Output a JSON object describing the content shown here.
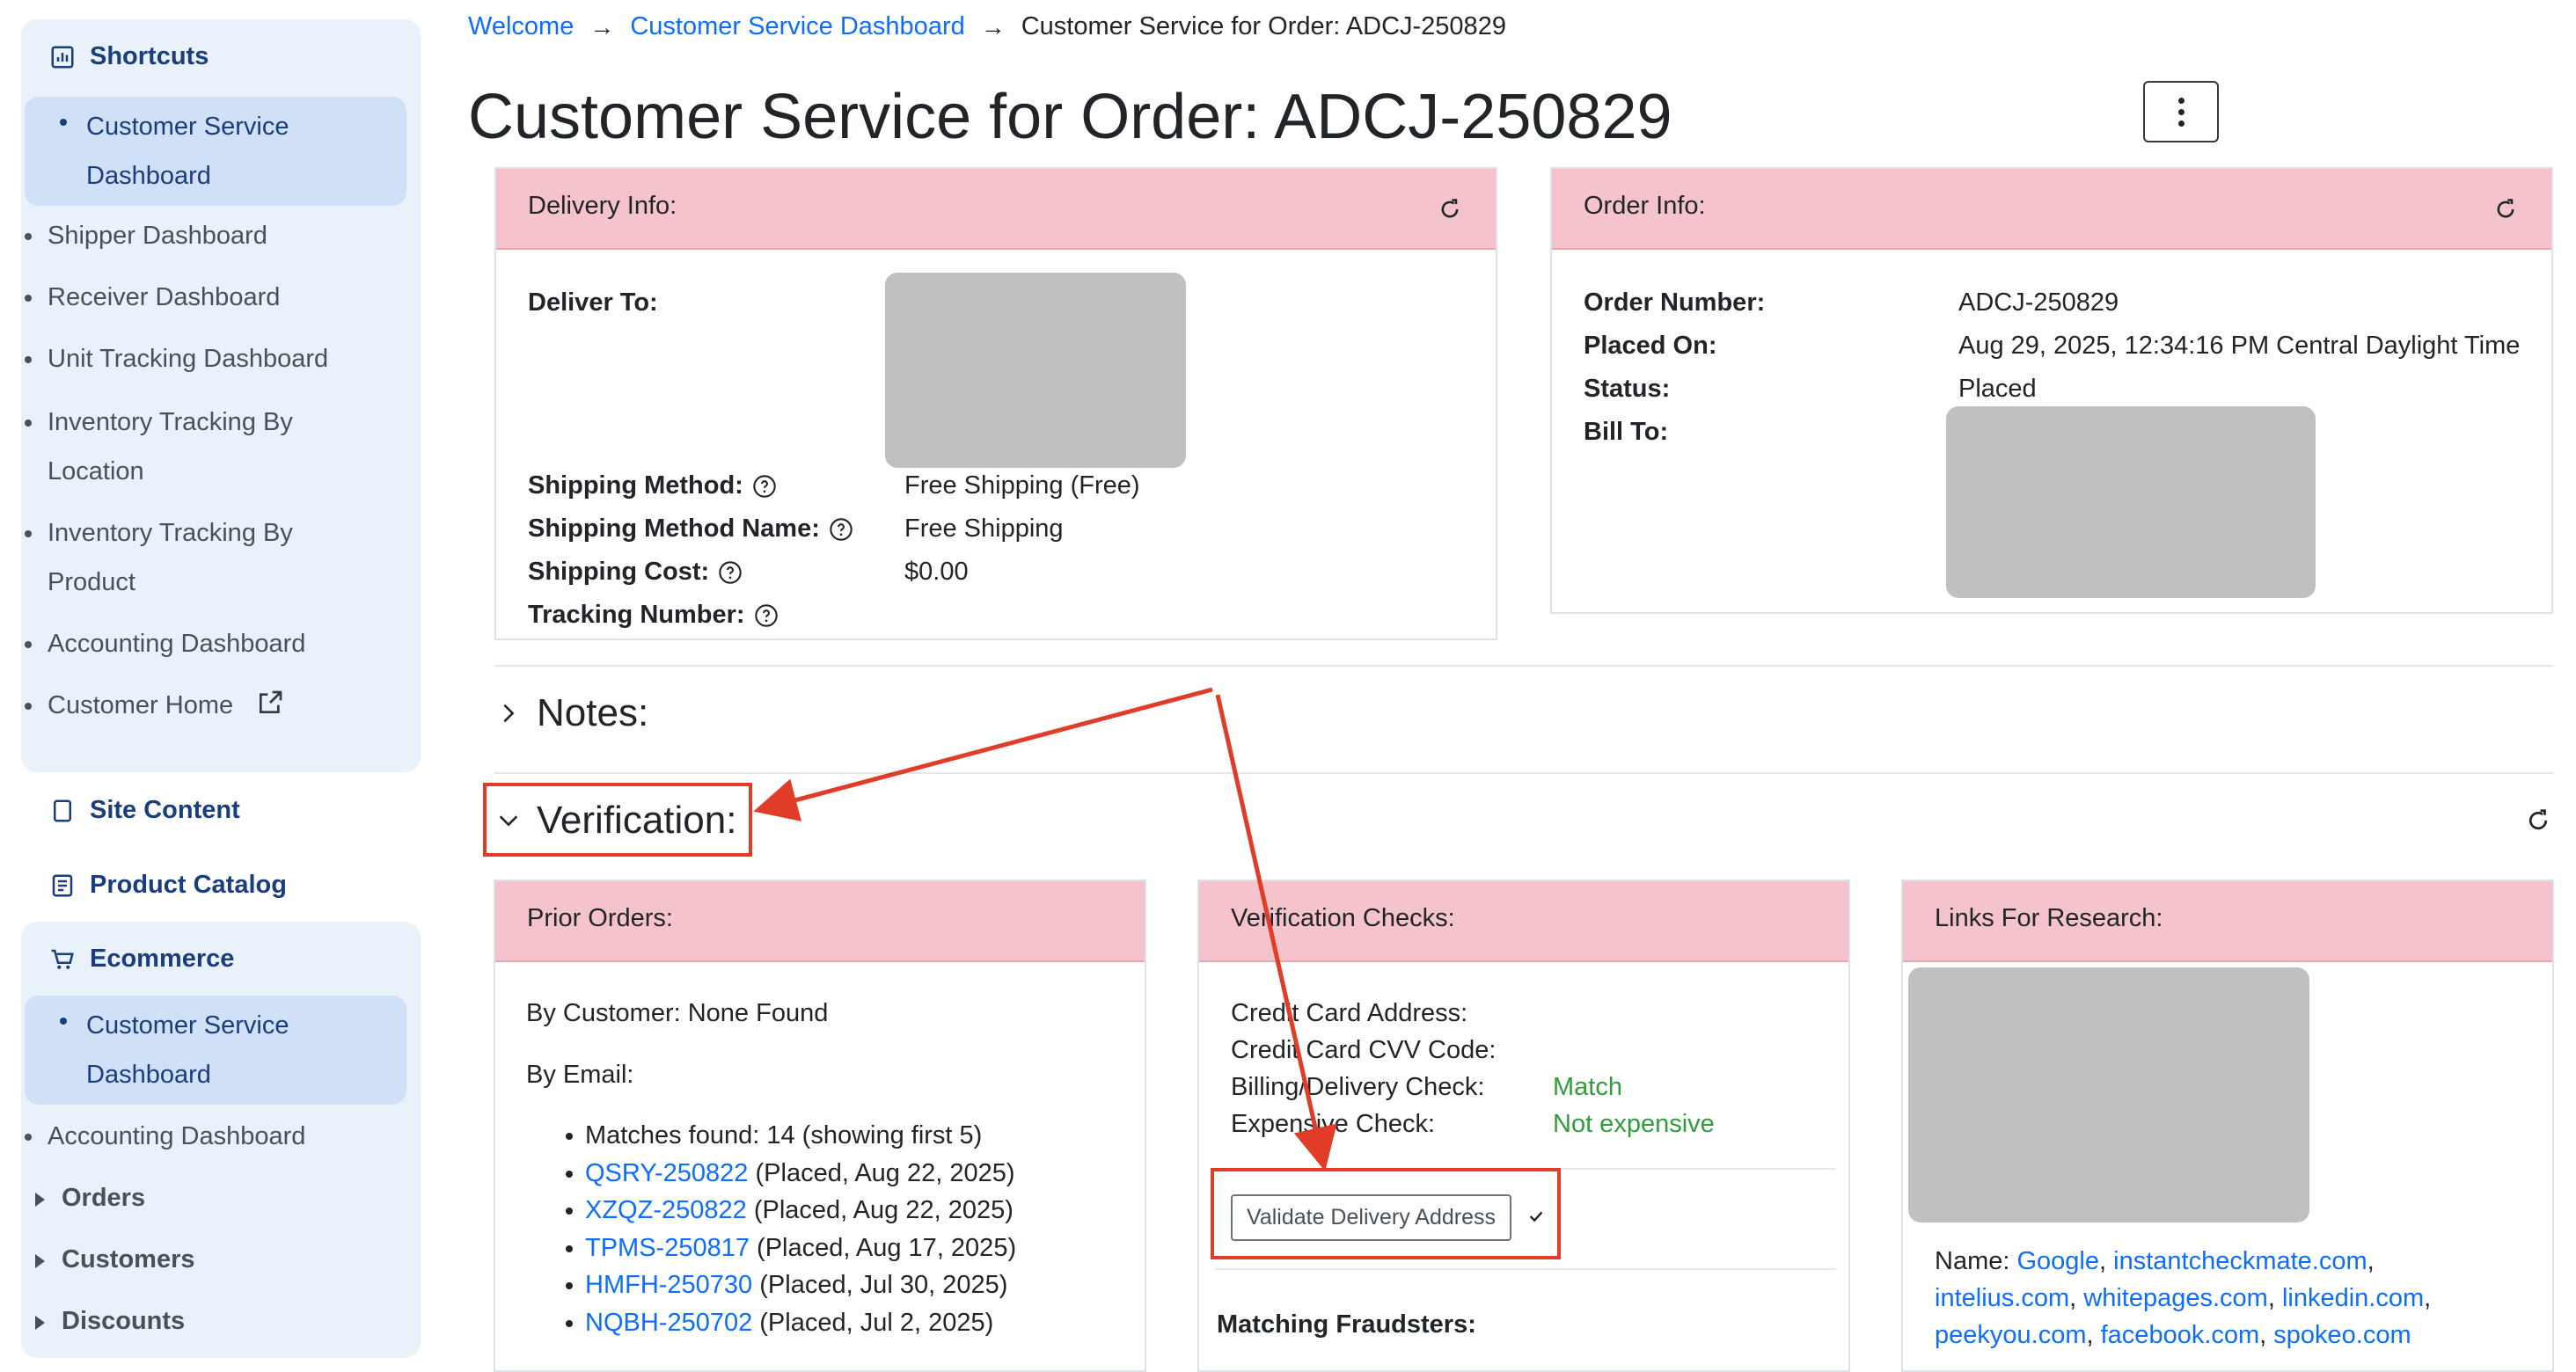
{
  "sidebar": {
    "shortcuts": {
      "heading": "Shortcuts",
      "items": [
        {
          "label": "Customer Service Dashboard"
        },
        {
          "label": "Shipper Dashboard"
        },
        {
          "label": "Receiver Dashboard"
        },
        {
          "label": "Unit Tracking Dashboard"
        },
        {
          "label": "Inventory Tracking By Location"
        },
        {
          "label": "Inventory Tracking By Product"
        },
        {
          "label": "Accounting Dashboard"
        },
        {
          "label": "Customer Home"
        }
      ]
    },
    "site_content": "Site Content",
    "product_catalog": "Product Catalog",
    "ecommerce": {
      "heading": "Ecommerce",
      "items": [
        {
          "label": "Customer Service Dashboard"
        },
        {
          "label": "Accounting Dashboard"
        }
      ],
      "groups": [
        "Orders",
        "Customers",
        "Discounts"
      ]
    }
  },
  "breadcrumb": {
    "welcome": "Welcome",
    "dashboard": "Customer Service Dashboard",
    "current": "Customer Service for Order: ADCJ-250829"
  },
  "page_title": "Customer Service for Order: ADCJ-250829",
  "delivery": {
    "header": "Delivery Info:",
    "deliver_to_label": "Deliver To:",
    "shipping_method_label": "Shipping Method:",
    "shipping_method_value": "Free Shipping (Free)",
    "shipping_method_name_label": "Shipping Method Name:",
    "shipping_method_name_value": "Free Shipping",
    "shipping_cost_label": "Shipping Cost:",
    "shipping_cost_value": "$0.00",
    "tracking_number_label": "Tracking Number:"
  },
  "order": {
    "header": "Order Info:",
    "order_number_label": "Order Number:",
    "order_number_value": "ADCJ-250829",
    "placed_on_label": "Placed On:",
    "placed_on_value": "Aug 29, 2025, 12:34:16 PM Central Daylight Time",
    "status_label": "Status:",
    "status_value": "Placed",
    "bill_to_label": "Bill To:"
  },
  "notes": {
    "title": "Notes:"
  },
  "verification": {
    "title": "Verification:"
  },
  "prior_orders": {
    "header": "Prior Orders:",
    "by_customer": "By Customer: None Found",
    "by_email": "By Email:",
    "matches": "Matches found: 14 (showing first 5)",
    "orders": [
      {
        "id": "QSRY-250822",
        "info": " (Placed, Aug 22, 2025)"
      },
      {
        "id": "XZQZ-250822",
        "info": " (Placed, Aug 22, 2025)"
      },
      {
        "id": "TPMS-250817",
        "info": " (Placed, Aug 17, 2025)"
      },
      {
        "id": "HMFH-250730",
        "info": " (Placed, Jul 30, 2025)"
      },
      {
        "id": "NQBH-250702",
        "info": " (Placed, Jul 2, 2025)"
      }
    ]
  },
  "verification_checks": {
    "header": "Verification Checks:",
    "cc_address_label": "Credit Card Address:",
    "cc_cvv_label": "Credit Card CVV Code:",
    "billing_delivery_label": "Billing/Delivery Check:",
    "billing_delivery_value": "Match",
    "expensive_label": "Expensive Check:",
    "expensive_value": "Not expensive",
    "validate_button": "Validate Delivery Address",
    "matching_fraudsters": "Matching Fraudsters:"
  },
  "research": {
    "header": "Links For Research:",
    "name_label": "Name: ",
    "links_line1": [
      "Google",
      "instantcheckmate.com"
    ],
    "links_line2": [
      "intelius.com",
      "whitepages.com",
      "linkedin.com"
    ],
    "links_line3": [
      "peekyou.com",
      "facebook.com",
      "spokeo.com"
    ]
  },
  "colors": {
    "card_header": "#f4c3cb",
    "link": "#0d6efd",
    "success": "#2e9e3a",
    "annotation": "#e03c28",
    "sidebar_panel": "#e9f1fb"
  }
}
